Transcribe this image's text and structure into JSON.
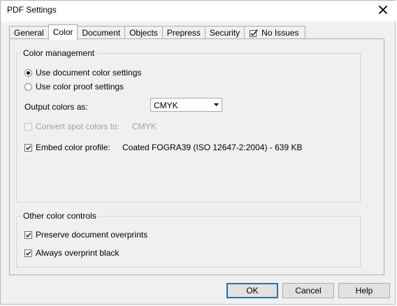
{
  "window": {
    "title": "PDF Settings"
  },
  "tabs": [
    {
      "label": "General",
      "active": false
    },
    {
      "label": "Color",
      "active": true
    },
    {
      "label": "Document",
      "active": false
    },
    {
      "label": "Objects",
      "active": false
    },
    {
      "label": "Prepress",
      "active": false
    },
    {
      "label": "Security",
      "active": false
    },
    {
      "label": "No Issues",
      "active": false,
      "icon": "preflight-check-icon"
    }
  ],
  "color_management": {
    "legend": "Color management",
    "radio_document": {
      "label": "Use document color settings",
      "selected": true
    },
    "radio_proof": {
      "label": "Use color proof settings",
      "selected": false
    },
    "output_colors_label": "Output colors as:",
    "output_colors_value": "CMYK",
    "convert_spot": {
      "label": "Convert spot colors to:",
      "checked": false,
      "enabled": false,
      "value": "CMYK"
    },
    "embed_profile": {
      "label": "Embed color profile:",
      "checked": true,
      "profile": "Coated FOGRA39 (ISO 12647-2:2004) - 639 KB"
    }
  },
  "other_controls": {
    "legend": "Other color controls",
    "preserve_overprints": {
      "label": "Preserve document overprints",
      "checked": true
    },
    "overprint_black": {
      "label": "Always overprint black",
      "checked": true
    }
  },
  "buttons": {
    "ok": "OK",
    "cancel": "Cancel",
    "help": "Help"
  },
  "colors": {
    "dialog_bg": "#f0f0f0",
    "accent_focus": "#0078d7"
  }
}
